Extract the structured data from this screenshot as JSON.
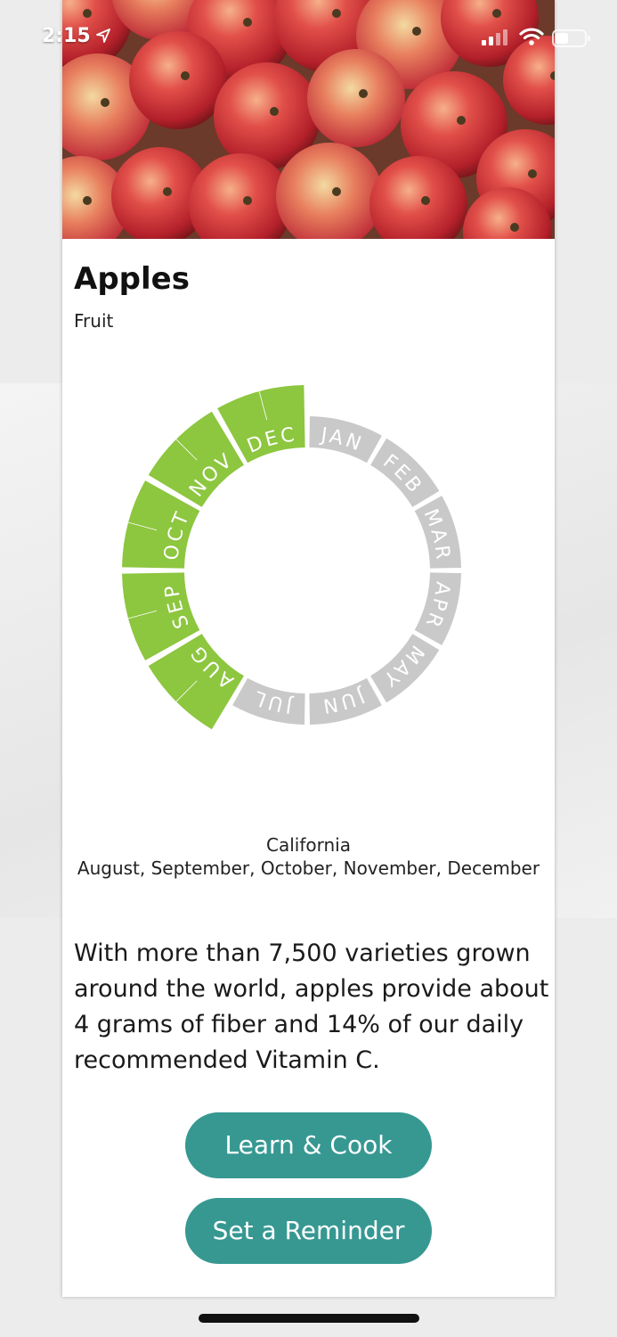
{
  "status_bar": {
    "time": "2:15",
    "icons": [
      "location-arrow-icon",
      "signal-icon",
      "wifi-icon",
      "battery-icon"
    ]
  },
  "produce": {
    "name": "Apples",
    "category": "Fruit",
    "image_icon": "apples-photo"
  },
  "season_wheel": {
    "months": [
      "JAN",
      "FEB",
      "MAR",
      "APR",
      "MAY",
      "JUN",
      "JUL",
      "AUG",
      "SEP",
      "OCT",
      "NOV",
      "DEC"
    ],
    "in_season": [
      false,
      false,
      false,
      false,
      false,
      false,
      false,
      true,
      true,
      true,
      true,
      true
    ],
    "colors": {
      "in_season": "#8dc63f",
      "out_of_season": "#c9c9c9",
      "label": "#ffffff"
    }
  },
  "availability": {
    "region": "California",
    "months_text": "August, September, October, November, December"
  },
  "description": "With more than 7,500 varieties grown around the world, apples provide about 4 grams of fiber and 14% of our daily recommended Vitamin C.",
  "actions": {
    "learn_cook_label": "Learn & Cook",
    "reminder_label": "Set a Reminder"
  },
  "colors": {
    "accent": "#379892"
  }
}
